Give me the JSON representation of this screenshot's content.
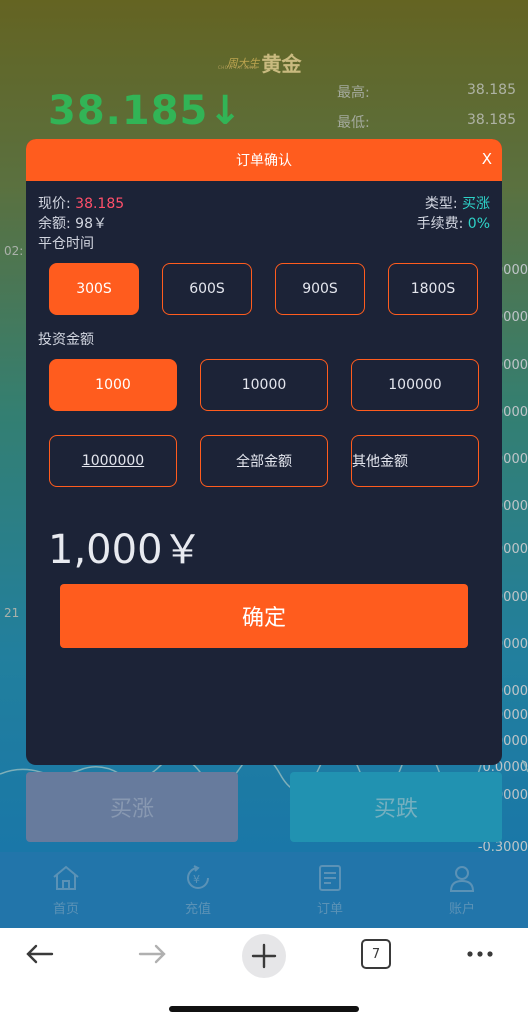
{
  "brand": {
    "mark": "周大生",
    "sub": "CHOW TAI SENG",
    "title": "黄金"
  },
  "quote": {
    "price": "38.185",
    "arrow": "↓"
  },
  "stats": [
    {
      "label": "最高:",
      "value": "38.185"
    },
    {
      "label": "最低:",
      "value": "38.185"
    }
  ],
  "side_numbers": [
    "0000",
    "0000",
    "0000",
    "0000",
    "0000",
    "0000",
    "0000",
    "0000",
    "0000",
    "0000",
    "0000",
    "0000",
    "0.0000",
    "0.0000",
    "-0.3000"
  ],
  "left_numbers": [
    "02:",
    "21"
  ],
  "modal": {
    "title": "订单确认",
    "close": "X",
    "current_price_label": "现价: ",
    "current_price": "38.185",
    "balance_label": "余额: ",
    "balance": "98￥",
    "type_label": "类型: ",
    "type_value": "买涨",
    "fee_label": "手续费: ",
    "fee_value": "0%",
    "close_time_label": "平仓时间",
    "time_options": [
      "300S",
      "600S",
      "900S",
      "1800S"
    ],
    "amount_label": "投资金额",
    "amount_options": [
      "1000",
      "10000",
      "100000",
      "1000000",
      "全部金额",
      "其他金额"
    ],
    "amount_display": "1,000￥",
    "confirm": "确定"
  },
  "actions": {
    "buy_up": "买涨",
    "buy_down": "买跌"
  },
  "tabs": [
    "首页",
    "充值",
    "订单",
    "账户"
  ],
  "browser": {
    "tab_count": "7"
  },
  "colors": {
    "accent": "#ff5c1e",
    "modal_bg": "#1c2337",
    "up_green": "#3ddc6a",
    "price_red": "#ff4f6a",
    "cyan": "#2ed3c8"
  }
}
